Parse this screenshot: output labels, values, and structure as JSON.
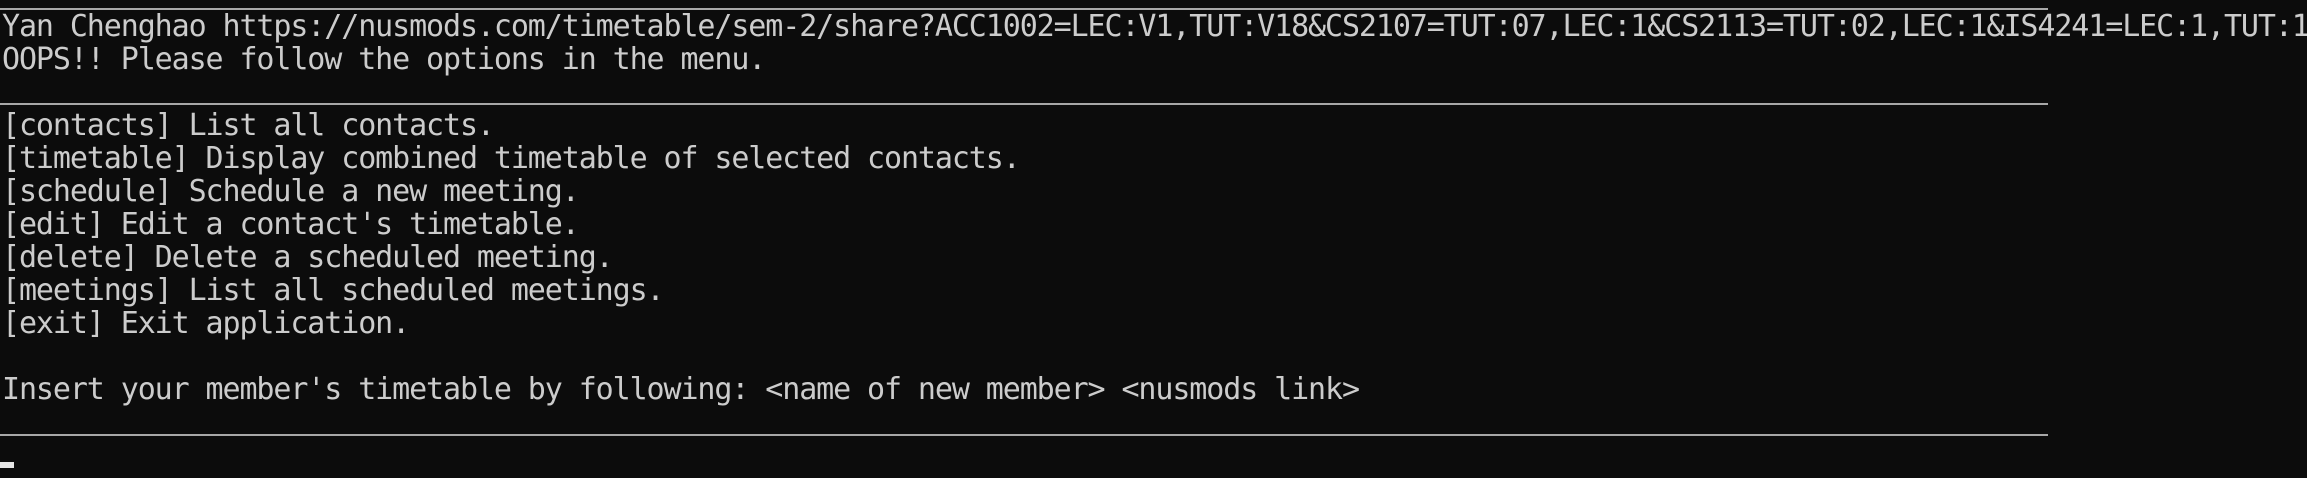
{
  "terminal": {
    "input_echo": "Yan Chenghao https://nusmods.com/timetable/sem-2/share?ACC1002=LEC:V1,TUT:V18&CS2107=TUT:07,LEC:1&CS2113=TUT:02,LEC:1&IS4241=LEC:1,TUT:1",
    "error_message": "OOPS!! Please follow the options in the menu.",
    "menu": [
      "[contacts] List all contacts.",
      "[timetable] Display combined timetable of selected contacts.",
      "[schedule] Schedule a new meeting.",
      "[edit] Edit a contact's timetable.",
      "[delete] Delete a scheduled meeting.",
      "[meetings] List all scheduled meetings.",
      "[exit] Exit application."
    ],
    "prompt": "Insert your member's timetable by following: <name of new member> <nusmods link>"
  }
}
